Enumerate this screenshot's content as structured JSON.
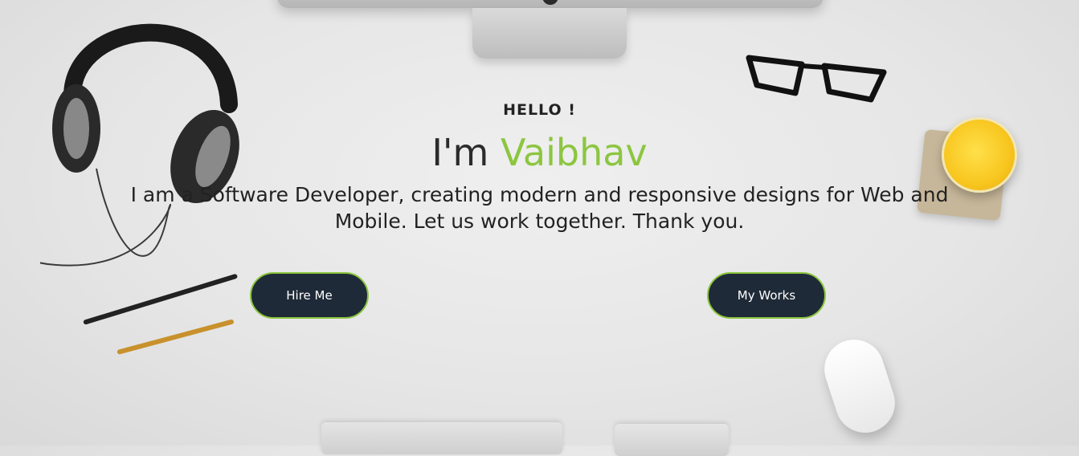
{
  "hero": {
    "greeting": "HELLO !",
    "headline_prefix": "I'm ",
    "headline_name": "Vaibhav",
    "tagline": "I am a Software Developer, creating modern and responsive designs for Web and Mobile. Let us work together. Thank you."
  },
  "buttons": {
    "hire": "Hire Me",
    "works": "My Works"
  },
  "colors": {
    "accent": "#8cc63f",
    "button_bg": "#1f2a38"
  },
  "decor": {
    "icons": [
      "monitor-icon",
      "headphones-icon",
      "glasses-icon",
      "juice-cup-icon",
      "pencil-icon",
      "mouse-icon",
      "keyboard-icon",
      "trackpad-icon"
    ]
  }
}
